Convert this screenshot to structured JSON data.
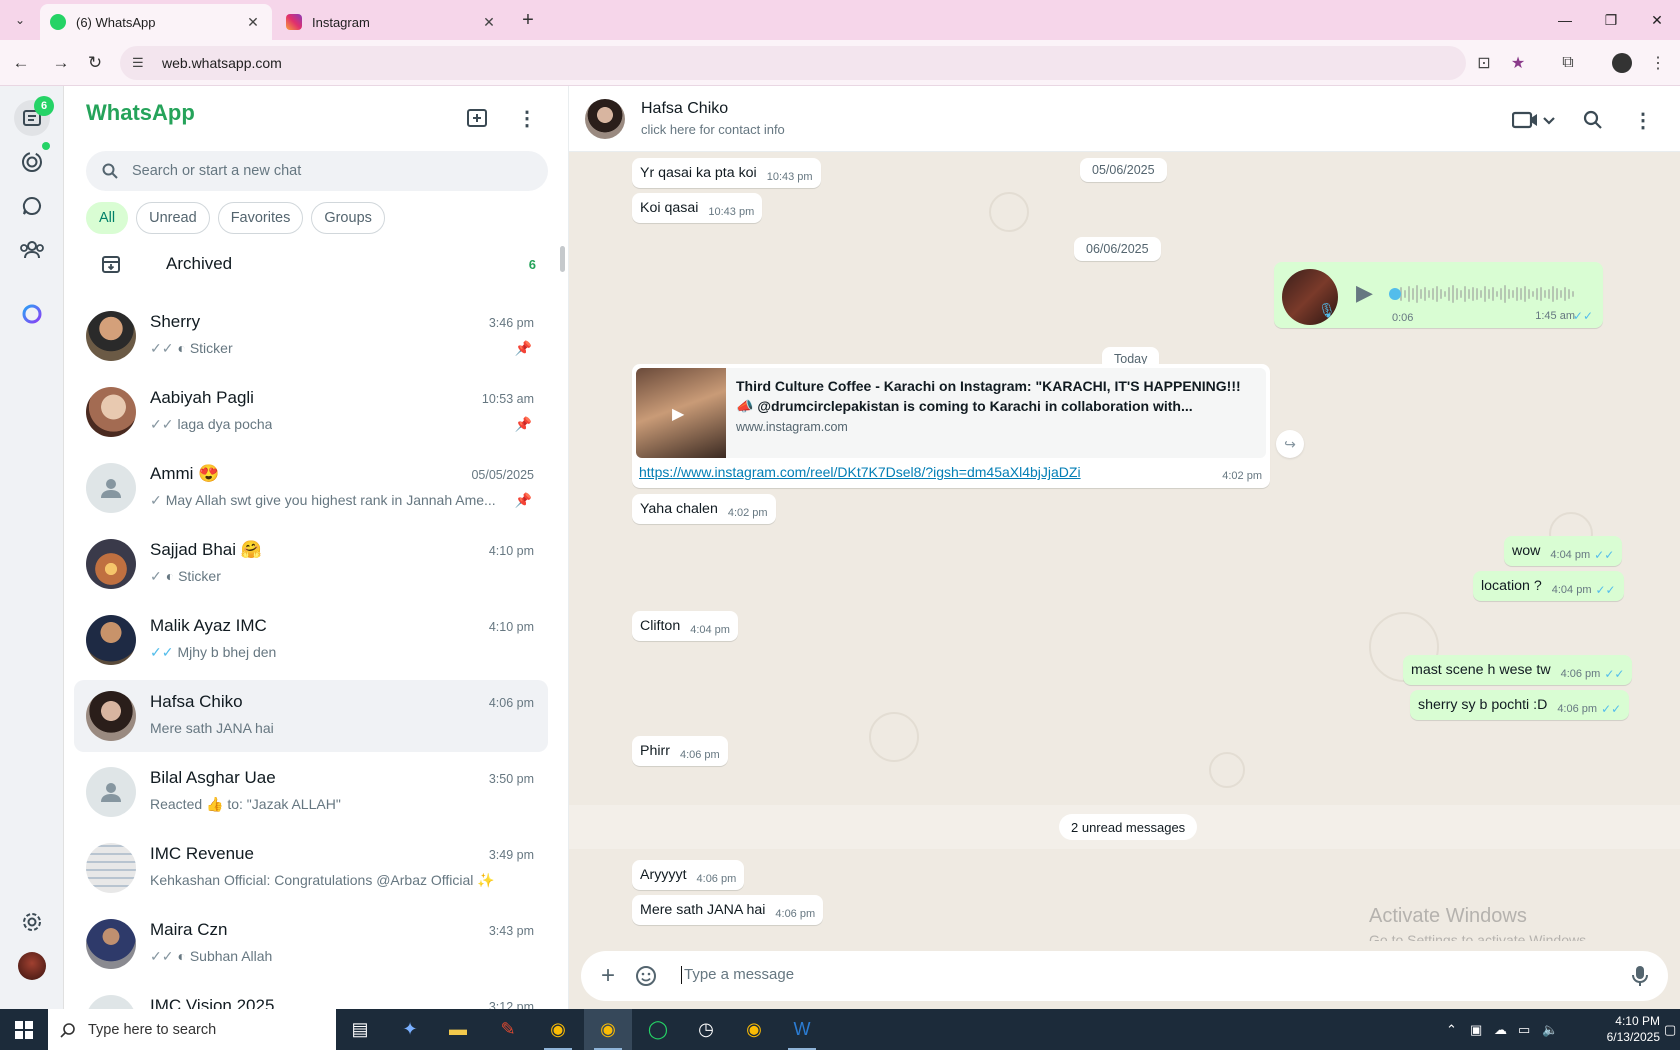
{
  "browser": {
    "tabs": [
      {
        "title": "(6) WhatsApp",
        "active": true,
        "favicon_color": "#25d366"
      },
      {
        "title": "Instagram",
        "active": false,
        "favicon_color": "#e1306c"
      }
    ],
    "url": "web.whatsapp.com"
  },
  "rail": {
    "chats_badge": "6",
    "accent": "#25d366"
  },
  "sidebar": {
    "app_title": "WhatsApp",
    "search_placeholder": "Search or start a new chat",
    "filters": [
      "All",
      "Unread",
      "Favorites",
      "Groups"
    ],
    "archived": {
      "label": "Archived",
      "count": "6"
    },
    "chats": [
      {
        "name": "Sherry",
        "time": "3:46 pm",
        "preview": "Sticker",
        "tick": "✓✓",
        "tick_style": "grey",
        "sticker": true,
        "pinned": true,
        "avatar": "photo"
      },
      {
        "name": "Aabiyah Pagli",
        "time": "10:53 am",
        "preview": "laga dya pocha",
        "tick": "✓✓",
        "tick_style": "grey",
        "pinned": true,
        "avatar": "photo"
      },
      {
        "name": "Ammi 😍",
        "time": "05/05/2025",
        "preview": "May Allah swt give you highest rank in Jannah  Ame...",
        "tick": "✓",
        "tick_style": "grey",
        "pinned": true,
        "avatar": "placeholder"
      },
      {
        "name": "Sajjad Bhai 🤗",
        "time": "4:10 pm",
        "preview": "Sticker",
        "tick": "✓",
        "tick_style": "grey",
        "sticker": true,
        "avatar": "photo"
      },
      {
        "name": "Malik Ayaz IMC",
        "time": "4:10 pm",
        "preview": "Mjhy b bhej den",
        "tick": "✓✓",
        "tick_style": "blue",
        "avatar": "photo"
      },
      {
        "name": "Hafsa Chiko",
        "time": "4:06 pm",
        "preview": "Mere sath JANA hai",
        "tick": "",
        "selected": true,
        "avatar": "photo"
      },
      {
        "name": "Bilal Asghar Uae",
        "time": "3:50 pm",
        "preview": "Reacted 👍 to: \"Jazak ALLAH\"",
        "tick": "",
        "avatar": "placeholder"
      },
      {
        "name": "IMC Revenue",
        "time": "3:49 pm",
        "preview": "Kehkashan Official: Congratulations @Arbaz Official ✨",
        "tick": "",
        "avatar": "photo"
      },
      {
        "name": "Maira Czn",
        "time": "3:43 pm",
        "preview": "Subhan Allah",
        "tick": "✓✓",
        "tick_style": "grey",
        "sticker": true,
        "avatar": "photo"
      },
      {
        "name": "IMC Vision 2025",
        "time": "3:12 pm",
        "preview": "",
        "tick": "",
        "avatar": "placeholder"
      }
    ]
  },
  "conversation": {
    "contact_name": "Hafsa Chiko",
    "contact_sub": "click here for contact info",
    "date_pills": [
      "05/06/2025",
      "06/06/2025",
      "Today"
    ],
    "messages": [
      {
        "dir": "in",
        "text": "Yr qasai ka pta koi",
        "time": "10:43 pm"
      },
      {
        "dir": "in",
        "text": "Koi qasai",
        "time": "10:43 pm"
      },
      {
        "dir": "in",
        "text": "Yaha chalen",
        "time": "4:02 pm"
      },
      {
        "dir": "out",
        "text": "wow",
        "time": "4:04 pm"
      },
      {
        "dir": "out",
        "text": "location ?",
        "time": "4:04 pm"
      },
      {
        "dir": "in",
        "text": "Clifton",
        "time": "4:04 pm"
      },
      {
        "dir": "out",
        "text": "mast scene h wese tw",
        "time": "4:06 pm"
      },
      {
        "dir": "out",
        "text": "sherry sy b pochti :D",
        "time": "4:06 pm"
      },
      {
        "dir": "in",
        "text": "Phirr",
        "time": "4:06 pm"
      },
      {
        "dir": "in",
        "text": "Aryyyyt",
        "time": "4:06 pm"
      },
      {
        "dir": "in",
        "text": "Mere sath JANA hai",
        "time": "4:06 pm"
      }
    ],
    "voice_note": {
      "duration": "0:06",
      "time": "1:45 am",
      "progress": 0.0
    },
    "link_preview": {
      "title": "Third Culture Coffee - Karachi on Instagram: \"KARACHI, IT'S HAPPENING!!! 📣 @drumcirclepakistan is coming to Karachi in collaboration with...",
      "domain": "www.instagram.com",
      "url": "https://www.instagram.com/reel/DKt7K7Dsel8/?igsh=dm45aXl4bjJjaDZi",
      "time": "4:02 pm"
    },
    "unread_label": "2 unread messages",
    "composer_placeholder": "Type a message",
    "watermark_title": "Activate Windows",
    "watermark_sub": "Go to Settings to activate Windows."
  },
  "taskbar": {
    "search_placeholder": "Type here to search",
    "time": "4:10 PM",
    "date": "6/13/2025"
  }
}
